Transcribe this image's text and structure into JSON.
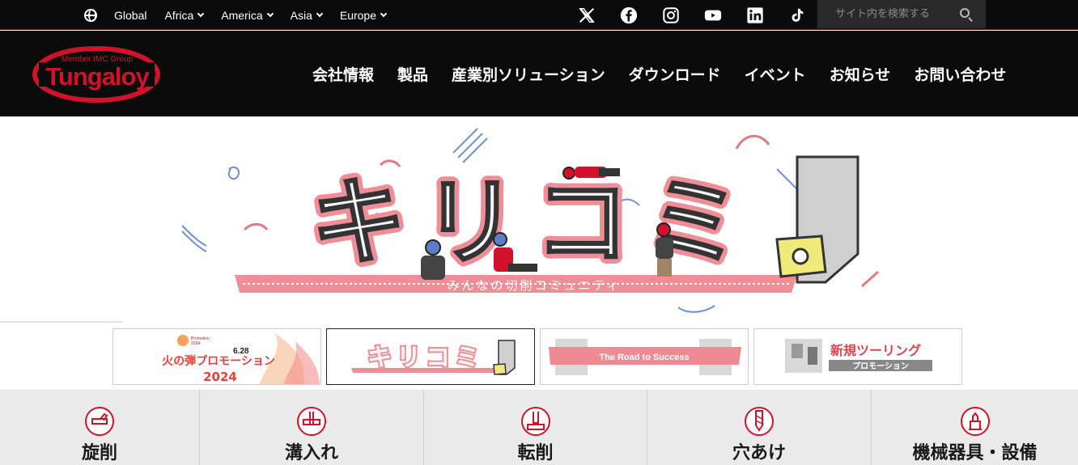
{
  "top_bar": {
    "regions": [
      {
        "label": "Global"
      },
      {
        "label": "Africa"
      },
      {
        "label": "America"
      },
      {
        "label": "Asia"
      },
      {
        "label": "Europe"
      }
    ],
    "socials": [
      "x-icon",
      "facebook-icon",
      "instagram-icon",
      "youtube-icon",
      "linkedin-icon",
      "tiktok-icon"
    ],
    "search_placeholder": "サイト内を検索する"
  },
  "logo": {
    "tagline": "Member IMC Group",
    "brand": "Tungaloy",
    "brand_color": "#d1122a"
  },
  "main_nav": {
    "items": [
      "会社情報",
      "製品",
      "産業別ソリューション",
      "ダウンロード",
      "イベント",
      "お知らせ",
      "お問い合わせ"
    ]
  },
  "hero": {
    "title": "キリコミ",
    "subtitle": "みんなの切削コミュニティ"
  },
  "thumbnails": [
    {
      "title": "火の弾プロモーション",
      "year": "2024",
      "badge": "Promotion",
      "date": "6.28"
    },
    {
      "title": "キリコミ"
    },
    {
      "title": "The Road to Success"
    },
    {
      "title": "新規ツーリング",
      "sub": "プロモーション"
    }
  ],
  "categories": [
    {
      "label": "旋削",
      "icon": "turning-icon"
    },
    {
      "label": "溝入れ",
      "icon": "grooving-icon"
    },
    {
      "label": "転削",
      "icon": "milling-icon"
    },
    {
      "label": "穴あけ",
      "icon": "drilling-icon"
    },
    {
      "label": "機械器具・設備",
      "icon": "machine-equipment-icon"
    }
  ]
}
